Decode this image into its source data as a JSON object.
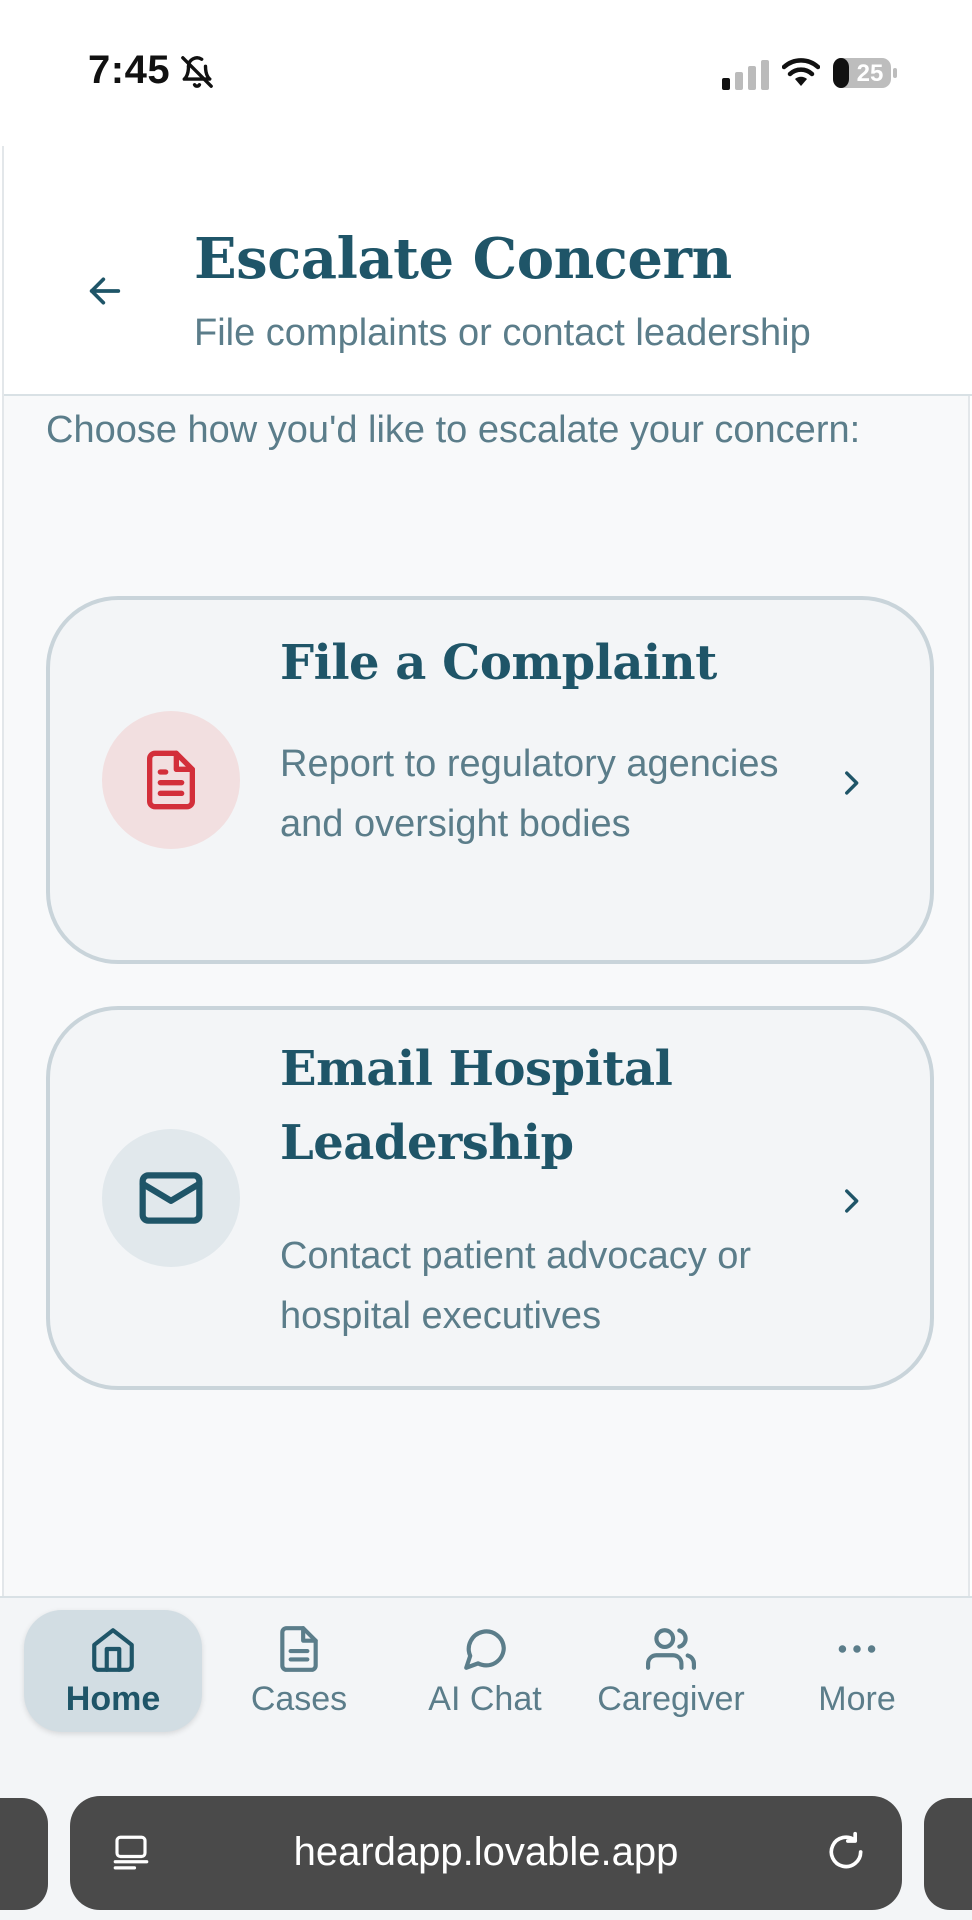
{
  "status_bar": {
    "time": "7:45",
    "battery": "25"
  },
  "header": {
    "title": "Escalate Concern",
    "subtitle": "File complaints or contact leadership"
  },
  "intro": "Choose how you'd like to escalate your concern:",
  "options": [
    {
      "title": "File a Complaint",
      "description": "Report to regulatory agencies and oversight bodies",
      "icon": "file-text-icon",
      "accent": "#d32f3a"
    },
    {
      "title": "Email Hospital Leadership",
      "description": "Contact patient advocacy or hospital executives",
      "icon": "mail-icon",
      "accent": "#1f5568"
    }
  ],
  "nav": {
    "items": [
      {
        "label": "Home",
        "icon": "home-icon",
        "active": true
      },
      {
        "label": "Cases",
        "icon": "file-text-icon",
        "active": false
      },
      {
        "label": "AI Chat",
        "icon": "message-circle-icon",
        "active": false
      },
      {
        "label": "Caregiver",
        "icon": "users-icon",
        "active": false
      },
      {
        "label": "More",
        "icon": "more-horizontal-icon",
        "active": false
      }
    ]
  },
  "browser": {
    "url": "heardapp.lovable.app"
  },
  "colors": {
    "primary": "#1f5568",
    "muted": "#5b7d8a",
    "fab": "#12566a",
    "danger": "#d32f3a"
  }
}
